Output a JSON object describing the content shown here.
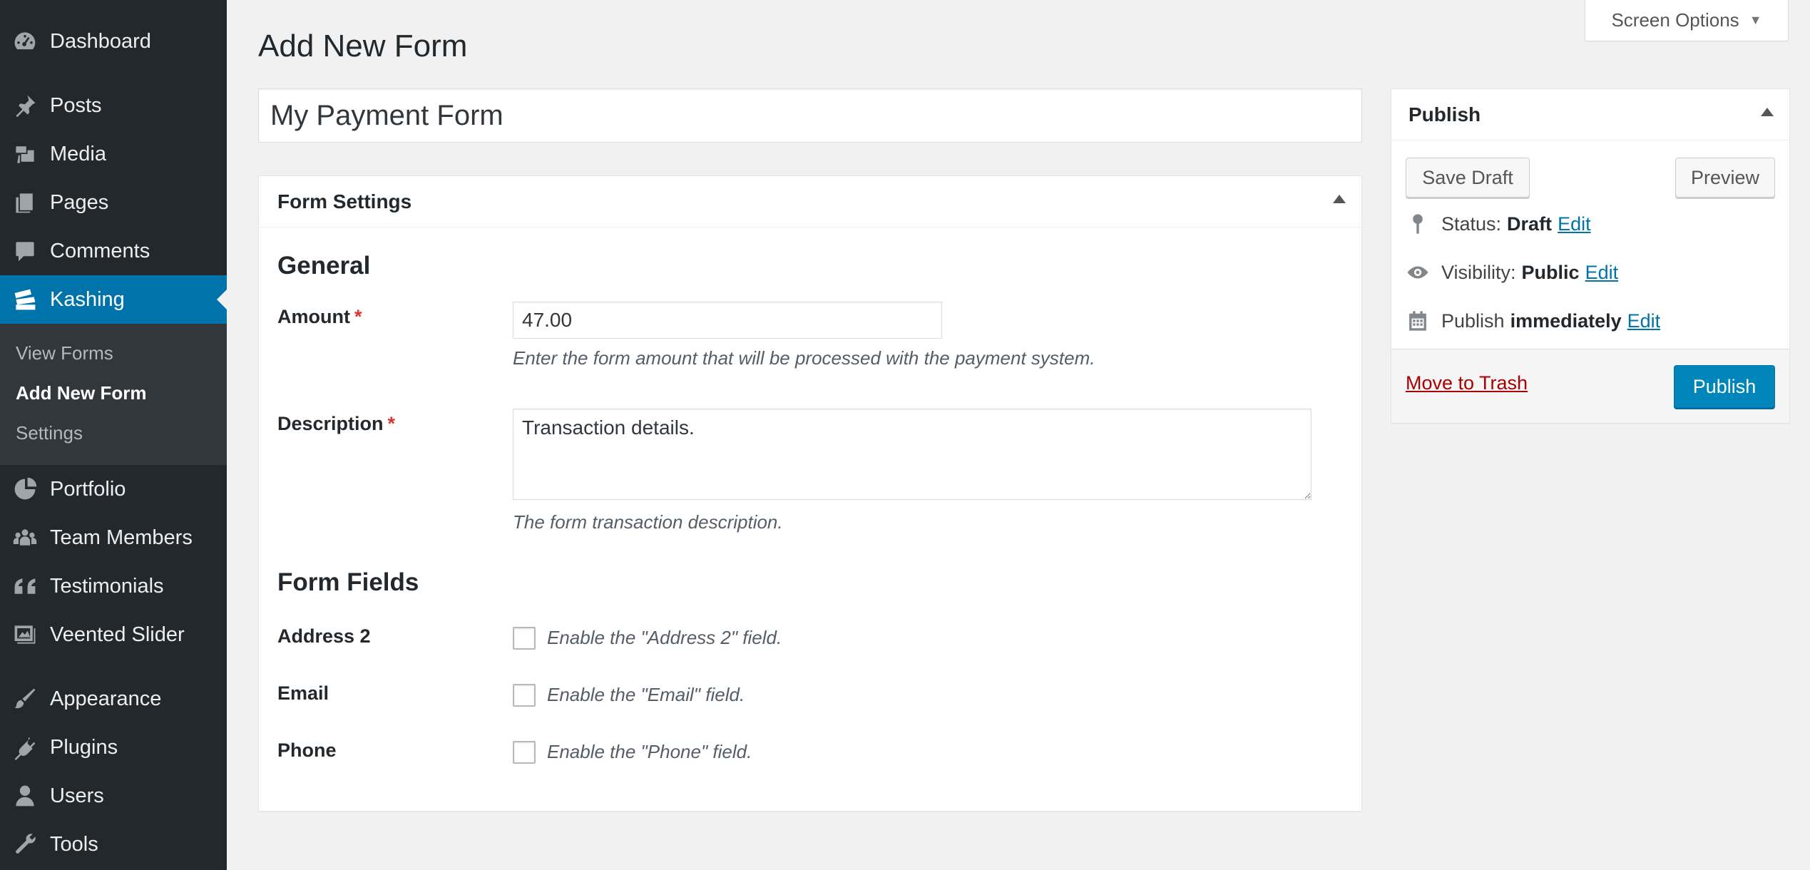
{
  "sidebar": {
    "items": [
      {
        "label": "Dashboard",
        "icon": "dashboard-icon"
      },
      {
        "label": "Posts",
        "icon": "pin-icon"
      },
      {
        "label": "Media",
        "icon": "media-icon"
      },
      {
        "label": "Pages",
        "icon": "pages-icon"
      },
      {
        "label": "Comments",
        "icon": "comment-icon"
      },
      {
        "label": "Kashing",
        "icon": "money-icon"
      },
      {
        "label": "Portfolio",
        "icon": "portfolio-icon"
      },
      {
        "label": "Team Members",
        "icon": "groups-icon"
      },
      {
        "label": "Testimonials",
        "icon": "quote-icon"
      },
      {
        "label": "Veented Slider",
        "icon": "slider-icon"
      },
      {
        "label": "Appearance",
        "icon": "brush-icon"
      },
      {
        "label": "Plugins",
        "icon": "plugin-icon"
      },
      {
        "label": "Users",
        "icon": "user-icon"
      },
      {
        "label": "Tools",
        "icon": "wrench-icon"
      }
    ],
    "submenu": [
      "View Forms",
      "Add New Form",
      "Settings"
    ],
    "active_color": "#0073aa"
  },
  "screen_options": "Screen Options",
  "page_title": "Add New Form",
  "post_title": "My Payment Form",
  "form_settings": {
    "title": "Form Settings",
    "general_title": "General",
    "amount_label": "Amount",
    "amount_value": "47.00",
    "amount_hint": "Enter the form amount that will be processed with the payment system.",
    "description_label": "Description",
    "description_value": "Transaction details.",
    "description_hint": "The form transaction description.",
    "required_mark": "*",
    "fields_title": "Form Fields",
    "fields": [
      {
        "label": "Address 2",
        "checkbox_label": "Enable the \"Address 2\" field."
      },
      {
        "label": "Email",
        "checkbox_label": "Enable the \"Email\" field."
      },
      {
        "label": "Phone",
        "checkbox_label": "Enable the \"Phone\" field."
      }
    ]
  },
  "publish": {
    "title": "Publish",
    "save_draft": "Save Draft",
    "preview": "Preview",
    "status_label": "Status:",
    "status_value": "Draft",
    "visibility_label": "Visibility:",
    "visibility_value": "Public",
    "publish_label": "Publish",
    "publish_value": "immediately",
    "edit": "Edit",
    "move_to_trash": "Move to Trash",
    "publish_button": "Publish"
  }
}
